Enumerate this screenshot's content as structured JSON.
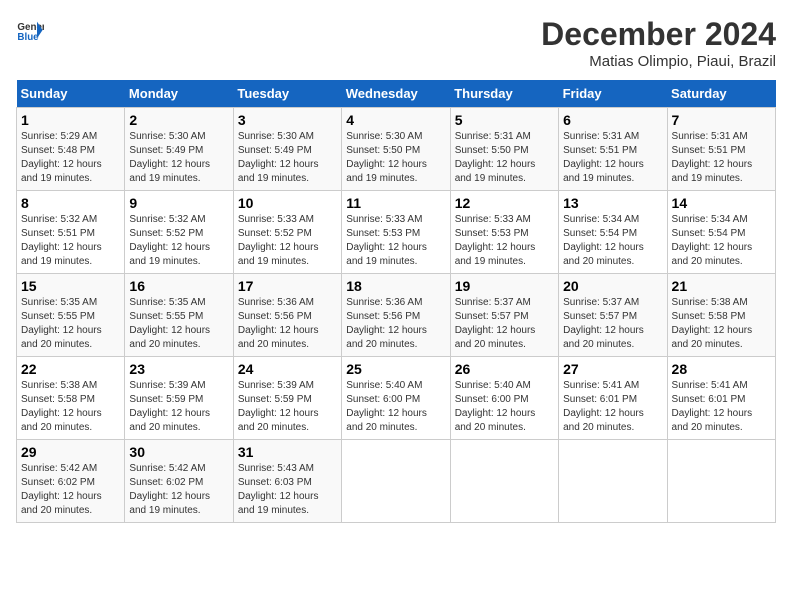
{
  "header": {
    "logo_general": "General",
    "logo_blue": "Blue",
    "month_title": "December 2024",
    "location": "Matias Olimpio, Piaui, Brazil"
  },
  "days_of_week": [
    "Sunday",
    "Monday",
    "Tuesday",
    "Wednesday",
    "Thursday",
    "Friday",
    "Saturday"
  ],
  "weeks": [
    [
      {
        "day": "1",
        "sunrise": "5:29 AM",
        "sunset": "5:48 PM",
        "daylight": "12 hours and 19 minutes."
      },
      {
        "day": "2",
        "sunrise": "5:30 AM",
        "sunset": "5:49 PM",
        "daylight": "12 hours and 19 minutes."
      },
      {
        "day": "3",
        "sunrise": "5:30 AM",
        "sunset": "5:49 PM",
        "daylight": "12 hours and 19 minutes."
      },
      {
        "day": "4",
        "sunrise": "5:30 AM",
        "sunset": "5:50 PM",
        "daylight": "12 hours and 19 minutes."
      },
      {
        "day": "5",
        "sunrise": "5:31 AM",
        "sunset": "5:50 PM",
        "daylight": "12 hours and 19 minutes."
      },
      {
        "day": "6",
        "sunrise": "5:31 AM",
        "sunset": "5:51 PM",
        "daylight": "12 hours and 19 minutes."
      },
      {
        "day": "7",
        "sunrise": "5:31 AM",
        "sunset": "5:51 PM",
        "daylight": "12 hours and 19 minutes."
      }
    ],
    [
      {
        "day": "8",
        "sunrise": "5:32 AM",
        "sunset": "5:51 PM",
        "daylight": "12 hours and 19 minutes."
      },
      {
        "day": "9",
        "sunrise": "5:32 AM",
        "sunset": "5:52 PM",
        "daylight": "12 hours and 19 minutes."
      },
      {
        "day": "10",
        "sunrise": "5:33 AM",
        "sunset": "5:52 PM",
        "daylight": "12 hours and 19 minutes."
      },
      {
        "day": "11",
        "sunrise": "5:33 AM",
        "sunset": "5:53 PM",
        "daylight": "12 hours and 19 minutes."
      },
      {
        "day": "12",
        "sunrise": "5:33 AM",
        "sunset": "5:53 PM",
        "daylight": "12 hours and 19 minutes."
      },
      {
        "day": "13",
        "sunrise": "5:34 AM",
        "sunset": "5:54 PM",
        "daylight": "12 hours and 20 minutes."
      },
      {
        "day": "14",
        "sunrise": "5:34 AM",
        "sunset": "5:54 PM",
        "daylight": "12 hours and 20 minutes."
      }
    ],
    [
      {
        "day": "15",
        "sunrise": "5:35 AM",
        "sunset": "5:55 PM",
        "daylight": "12 hours and 20 minutes."
      },
      {
        "day": "16",
        "sunrise": "5:35 AM",
        "sunset": "5:55 PM",
        "daylight": "12 hours and 20 minutes."
      },
      {
        "day": "17",
        "sunrise": "5:36 AM",
        "sunset": "5:56 PM",
        "daylight": "12 hours and 20 minutes."
      },
      {
        "day": "18",
        "sunrise": "5:36 AM",
        "sunset": "5:56 PM",
        "daylight": "12 hours and 20 minutes."
      },
      {
        "day": "19",
        "sunrise": "5:37 AM",
        "sunset": "5:57 PM",
        "daylight": "12 hours and 20 minutes."
      },
      {
        "day": "20",
        "sunrise": "5:37 AM",
        "sunset": "5:57 PM",
        "daylight": "12 hours and 20 minutes."
      },
      {
        "day": "21",
        "sunrise": "5:38 AM",
        "sunset": "5:58 PM",
        "daylight": "12 hours and 20 minutes."
      }
    ],
    [
      {
        "day": "22",
        "sunrise": "5:38 AM",
        "sunset": "5:58 PM",
        "daylight": "12 hours and 20 minutes."
      },
      {
        "day": "23",
        "sunrise": "5:39 AM",
        "sunset": "5:59 PM",
        "daylight": "12 hours and 20 minutes."
      },
      {
        "day": "24",
        "sunrise": "5:39 AM",
        "sunset": "5:59 PM",
        "daylight": "12 hours and 20 minutes."
      },
      {
        "day": "25",
        "sunrise": "5:40 AM",
        "sunset": "6:00 PM",
        "daylight": "12 hours and 20 minutes."
      },
      {
        "day": "26",
        "sunrise": "5:40 AM",
        "sunset": "6:00 PM",
        "daylight": "12 hours and 20 minutes."
      },
      {
        "day": "27",
        "sunrise": "5:41 AM",
        "sunset": "6:01 PM",
        "daylight": "12 hours and 20 minutes."
      },
      {
        "day": "28",
        "sunrise": "5:41 AM",
        "sunset": "6:01 PM",
        "daylight": "12 hours and 20 minutes."
      }
    ],
    [
      {
        "day": "29",
        "sunrise": "5:42 AM",
        "sunset": "6:02 PM",
        "daylight": "12 hours and 20 minutes."
      },
      {
        "day": "30",
        "sunrise": "5:42 AM",
        "sunset": "6:02 PM",
        "daylight": "12 hours and 19 minutes."
      },
      {
        "day": "31",
        "sunrise": "5:43 AM",
        "sunset": "6:03 PM",
        "daylight": "12 hours and 19 minutes."
      },
      null,
      null,
      null,
      null
    ]
  ]
}
